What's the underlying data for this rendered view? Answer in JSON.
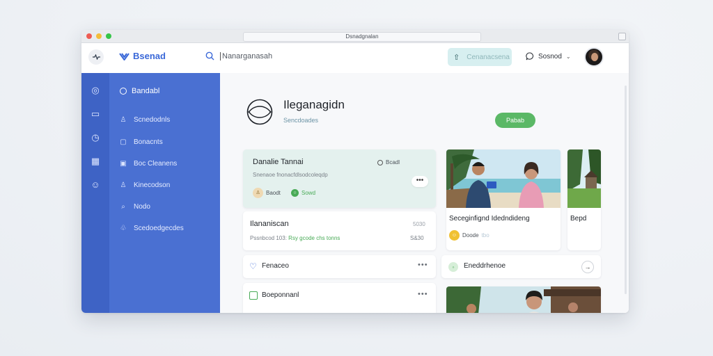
{
  "window": {
    "url": "Dsnadgnalan"
  },
  "header": {
    "brand": "Bsenad",
    "search_value": "Nanarganasah",
    "action_label": "Cenanacsena",
    "user_label": "Sosnod",
    "icons": {
      "menu": "pulse-icon",
      "search": "search-icon",
      "action": "upload-icon",
      "user": "chat-icon",
      "chevron": "chevron-down-icon"
    }
  },
  "sidebar": {
    "heading": "Bandabl",
    "items": [
      {
        "label": "Scnedodnls",
        "icon": "user-icon"
      },
      {
        "label": "Bonacnts",
        "icon": "square-icon"
      },
      {
        "label": "Boc Cleanens",
        "icon": "grid-icon"
      },
      {
        "label": "Kinecodson",
        "icon": "user-icon"
      },
      {
        "label": "Nodo",
        "icon": "search-icon"
      },
      {
        "label": "Scedoedgecdes",
        "icon": "people-icon"
      }
    ],
    "rail_icons": [
      "compass-icon",
      "inbox-icon",
      "clock-icon",
      "calendar-icon",
      "smile-icon"
    ]
  },
  "page": {
    "title": "Ileganagidn",
    "subtitle": "Sencdoades",
    "primary_button": "Pabab"
  },
  "cards": {
    "featured": {
      "title": "Danalie Tannai",
      "tag": "Bcadl",
      "desc": "Snenaoe fnonacfdlsodcoleqdp",
      "person": "Baodt",
      "status": "Sowd"
    },
    "item1": {
      "title": "Ilananiscan",
      "time": "5030",
      "meta": "Pssnbcod 103:",
      "meta_green": "Rsy gcode chs tonns",
      "meta_right": "S&30"
    },
    "photo1": {
      "caption": "Seceginfignd Idedndideng",
      "meta": "Doode",
      "meta_light": "tbo"
    },
    "photo2": {
      "caption": "Bepd"
    },
    "item2": {
      "title": "Fenaceo"
    },
    "item3": {
      "title": "Eneddrhenoe"
    },
    "item4": {
      "title": "Boeponnanl"
    }
  },
  "colors": {
    "rail": "#3e63c5",
    "sidebar": "#4a70d2",
    "accent": "#5bb866",
    "highlight": "#e4f1ee"
  }
}
